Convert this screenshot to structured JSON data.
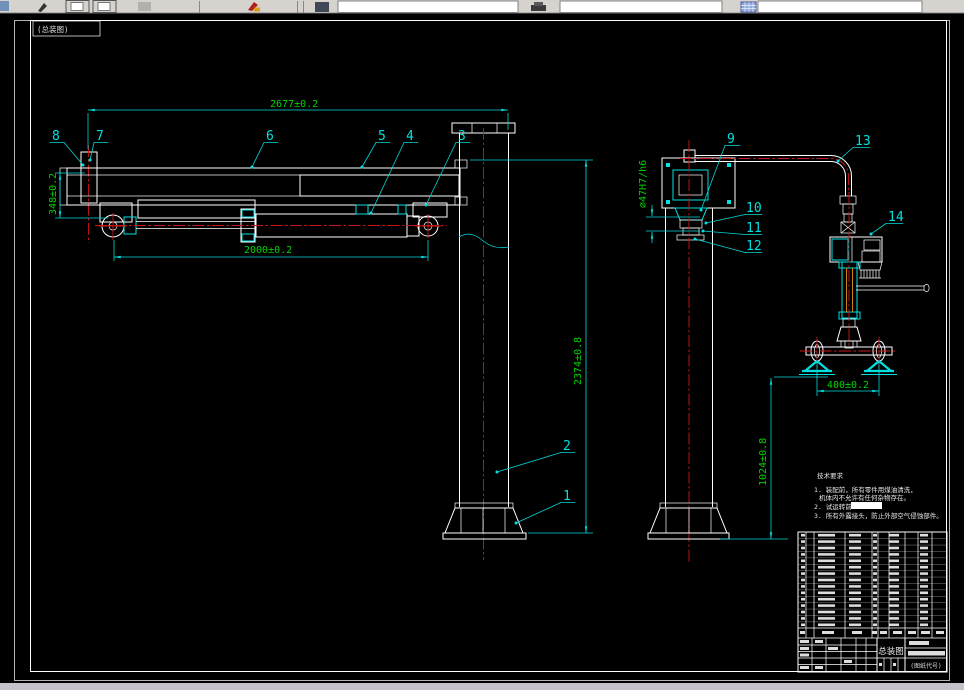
{
  "viewport_label": "(总装图)",
  "dims": {
    "arm_length": "2677±0.2",
    "arm_height": "348±0.2",
    "cyl_stroke": "2000±0.2",
    "col_height": "2374±0.8",
    "shaft_fit": "⌀47H7/h6",
    "gripper_width": "400±0.2",
    "gripper_height": "1024±0.8"
  },
  "labels": {
    "p1": "1",
    "p2": "2",
    "p3": "3",
    "p4": "4",
    "p5": "5",
    "p6": "6",
    "p7": "7",
    "p8": "8",
    "p9": "9",
    "p10": "10",
    "p11": "11",
    "p12": "12",
    "p13": "13",
    "p14": "14"
  },
  "notes": {
    "title": "技术要求",
    "line1": "1. 装配前，所有零件用煤油清洗，",
    "line2": "机体内不允许有任何杂物存在。",
    "line3": "2. 试运转前",
    "line4": "3. 所有外露接头，防止外部空气侵蚀部件。"
  },
  "title_block": {
    "drawing_name": "总装图",
    "code_label": "(图纸代号)"
  }
}
